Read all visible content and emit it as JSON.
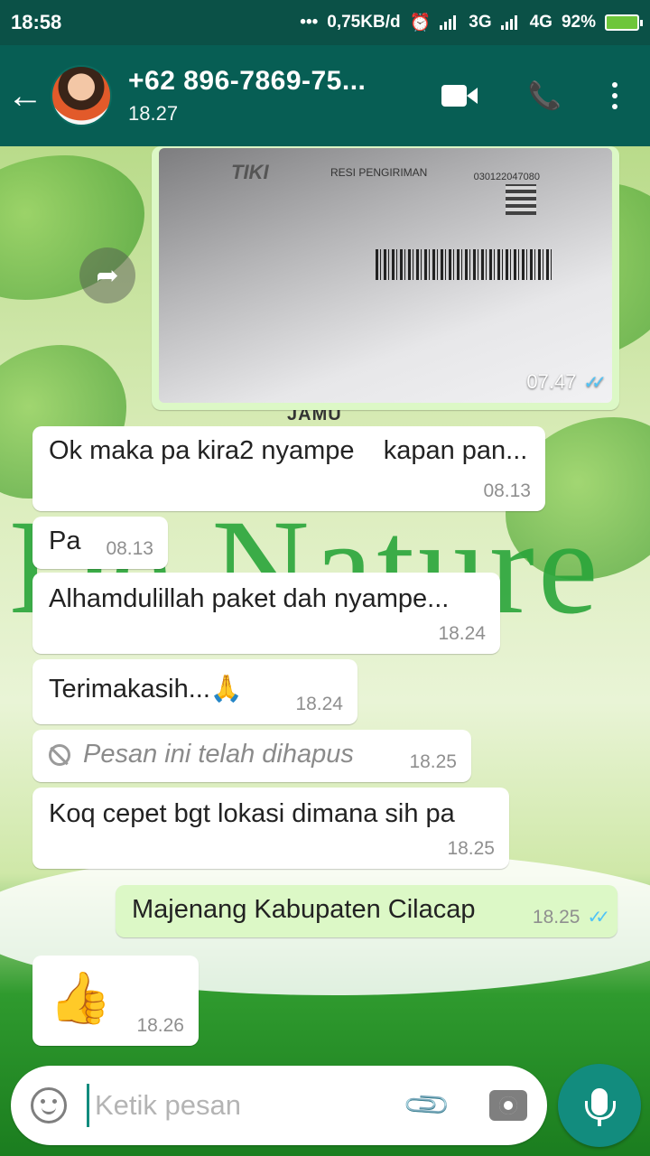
{
  "statusbar": {
    "time": "18:58",
    "dots": "•••",
    "speed": "0,75KB/d",
    "network1": "3G",
    "network2": "4G",
    "battery": "92%"
  },
  "header": {
    "title": "+62 896-7869-75...",
    "last_seen": "18.27"
  },
  "wallpaper": {
    "brand_text": "De Nature",
    "top_text": "JAMU"
  },
  "image_message": {
    "time": "07.47",
    "ticks": "✓✓",
    "receipt_brand": "TIKI",
    "receipt_heading": "RESI PENGIRIMAN",
    "receipt_number": "030122047080"
  },
  "messages": [
    {
      "direction": "in",
      "text": "Ok maka pa kira2 nyampe    kapan pan...",
      "time": "08.13"
    },
    {
      "direction": "in",
      "text": "Pa",
      "time": "08.13"
    },
    {
      "direction": "in",
      "text": "Alhamdulillah paket dah nyampe...",
      "time": "18.24"
    },
    {
      "direction": "in",
      "text": "Terimakasih...🙏",
      "time": "18.24"
    },
    {
      "direction": "in",
      "text": "Pesan ini telah dihapus",
      "time": "18.25",
      "deleted": true
    },
    {
      "direction": "in",
      "text": "Koq cepet bgt lokasi dimana sih pa",
      "time": "18.25"
    },
    {
      "direction": "out",
      "text": "Majenang Kabupaten Cilacap",
      "time": "18.25",
      "ticks": "✓✓"
    },
    {
      "direction": "in",
      "text": "👍",
      "time": "18.26"
    }
  ],
  "composer": {
    "placeholder": "Ketik pesan"
  },
  "colors": {
    "header": "#075e54",
    "statusbar": "#0b5147",
    "outgoing_bubble": "#dcf8c6",
    "read_ticks": "#4fc3f7",
    "fab": "#128c7e"
  }
}
